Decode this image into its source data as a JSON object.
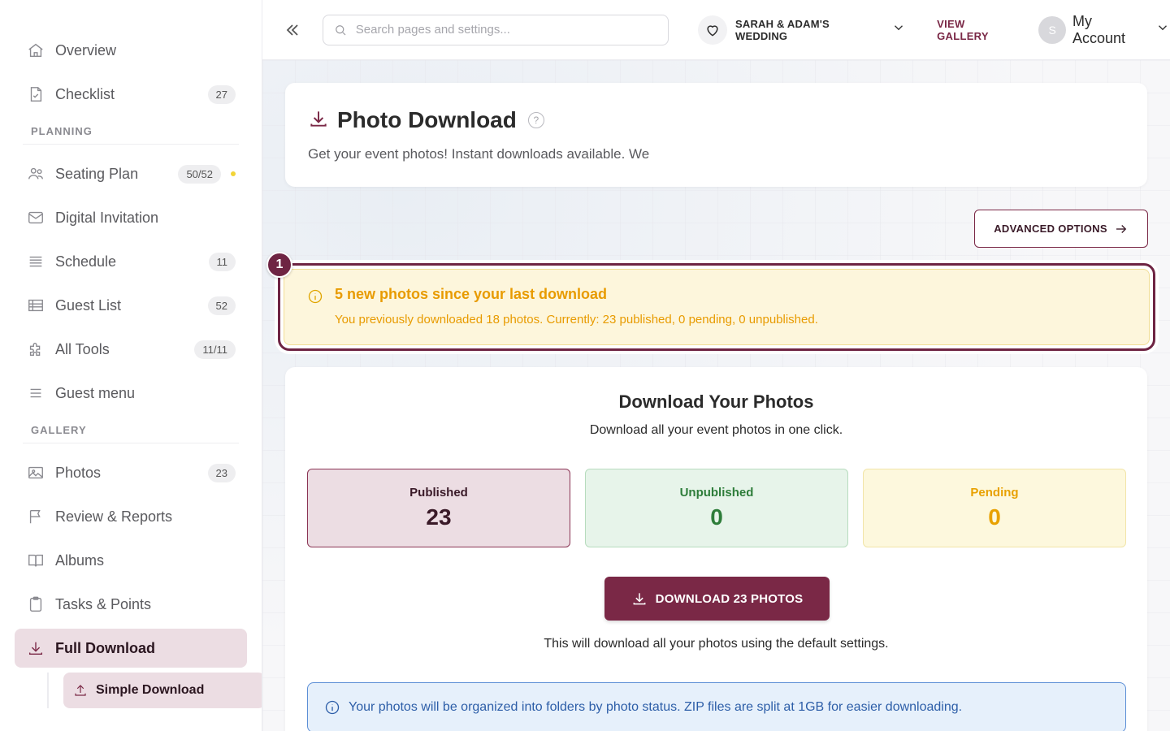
{
  "sidebar": {
    "top_items": [
      {
        "label": "Overview",
        "badge": ""
      },
      {
        "label": "Checklist",
        "badge": "27"
      }
    ],
    "planning_title": "PLANNING",
    "planning_items": [
      {
        "label": "Seating Plan",
        "badge": "50/52"
      },
      {
        "label": "Digital Invitation",
        "badge": ""
      },
      {
        "label": "Schedule",
        "badge": "11"
      },
      {
        "label": "Guest List",
        "badge": "52"
      },
      {
        "label": "All Tools",
        "badge": "11/11"
      },
      {
        "label": "Guest menu",
        "badge": ""
      }
    ],
    "gallery_title": "GALLERY",
    "gallery_items": [
      {
        "label": "Photos",
        "badge": "23"
      },
      {
        "label": "Review & Reports",
        "badge": ""
      },
      {
        "label": "Albums",
        "badge": ""
      },
      {
        "label": "Tasks & Points",
        "badge": ""
      },
      {
        "label": "Full Download",
        "badge": ""
      }
    ],
    "sub_item": "Simple Download"
  },
  "topbar": {
    "search_placeholder": "Search pages and settings...",
    "event_name": "SARAH & ADAM'S WEDDING",
    "view_gallery": "VIEW GALLERY",
    "avatar_initial": "S",
    "account_label": "My Account"
  },
  "header": {
    "title": "Photo Download",
    "help": "?",
    "subtitle": "Get your event photos! Instant downloads available. We"
  },
  "advanced_options": "ADVANCED OPTIONS",
  "alert": {
    "step": "1",
    "title": "5 new photos since your last download",
    "text": "You previously downloaded 18 photos. Currently: 23 published, 0 pending, 0 unpublished."
  },
  "download": {
    "title": "Download Your Photos",
    "subtitle": "Download all your event photos in one click.",
    "stats": {
      "published": {
        "label": "Published",
        "value": "23"
      },
      "unpublished": {
        "label": "Unpublished",
        "value": "0"
      },
      "pending": {
        "label": "Pending",
        "value": "0"
      }
    },
    "button_label": "DOWNLOAD 23 PHOTOS",
    "note": "This will download all your photos using the default settings.",
    "info": "Your photos will be organized into folders by photo status. ZIP files are split at 1GB for easier downloading."
  },
  "colors": {
    "brand": "#7a2846",
    "alert_text": "#e89b00",
    "info_text": "#2d5ea8"
  }
}
